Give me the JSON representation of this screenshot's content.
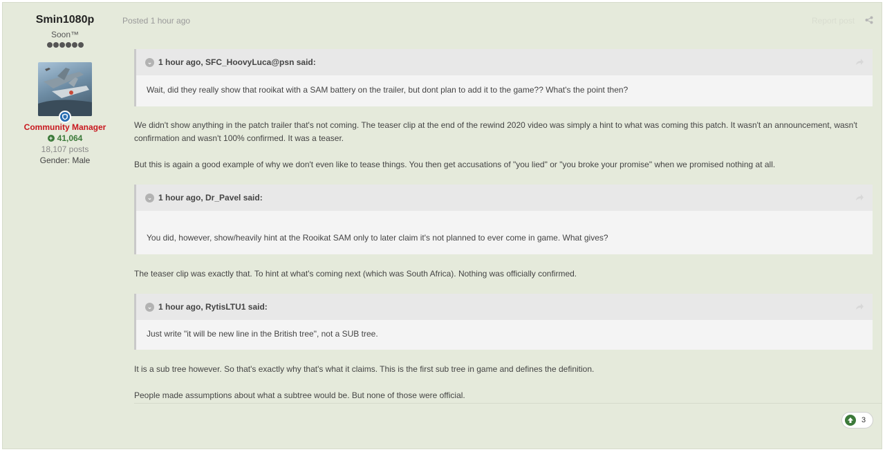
{
  "author": {
    "name": "Smin1080p",
    "title": "Soon™",
    "pips": 6,
    "group": "Community Manager",
    "reputation": "41,064",
    "posts": "18,107 posts",
    "gender": "Gender: Male"
  },
  "meta": {
    "posted": "Posted 1 hour ago",
    "report": "Report post"
  },
  "quotes": [
    {
      "header": "1 hour ago, SFC_HoovyLuca@psn said:",
      "text": "Wait, did they really show that rooikat with a SAM battery on the trailer, but dont plan to add it to the game?? What's the point then?"
    },
    {
      "header": "1 hour ago, Dr_Pavel said:",
      "text": "You did, however, show/heavily hint at the Rooikat SAM only to later claim it's not planned to ever come in game. What gives?"
    },
    {
      "header": "1 hour ago, RytisLTU1 said:",
      "text": "Just write \"it will be new line in the British tree\", not a SUB tree."
    }
  ],
  "paragraphs": [
    "We didn't show anything in the patch trailer that's not coming. The teaser clip at the end of the rewind 2020 video was simply a hint to what was coming this patch. It wasn't an announcement, wasn't confirmation and wasn't 100% confirmed. It was a teaser.",
    "But this is again a good example of why we don't even like to tease things. You then get accusations of \"you lied\" or \"you broke your promise\" when we promised nothing at all.",
    "The teaser clip was exactly that. To hint at what's coming next (which was South Africa). Nothing was officially confirmed.",
    "It is a sub tree however. So that's exactly why that's what it claims. This is the first sub tree in game and defines the definition.",
    "People made assumptions about what a subtree would be. But none of those were official."
  ],
  "reaction": {
    "count": "3"
  },
  "colors": {
    "group": "#c8171e",
    "reputation": "#3c7a3a",
    "post_bg": "#e5eadb"
  }
}
